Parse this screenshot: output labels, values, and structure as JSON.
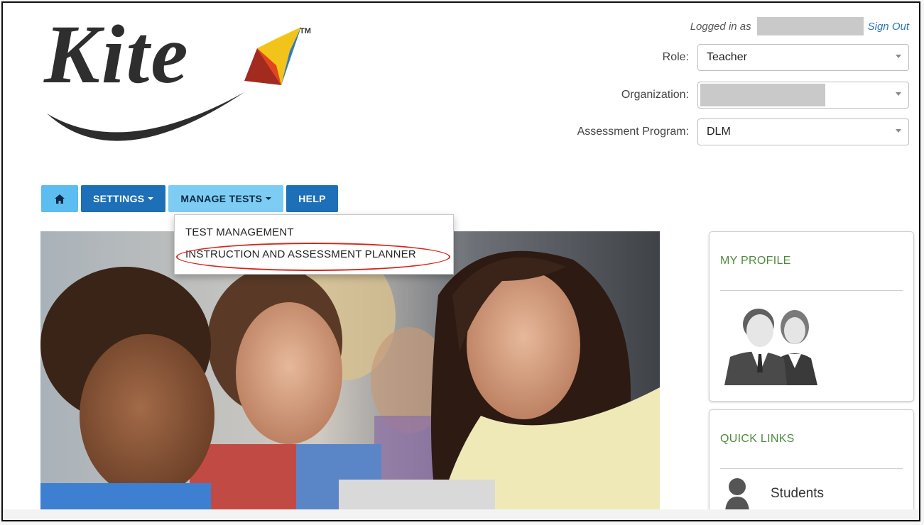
{
  "brand": {
    "name": "Kite",
    "trademark": "TM"
  },
  "session": {
    "logged_in_label": "Logged in as",
    "sign_out": "Sign Out"
  },
  "fields": {
    "role": {
      "label": "Role:",
      "value": "Teacher"
    },
    "organization": {
      "label": "Organization:",
      "value": ""
    },
    "program": {
      "label": "Assessment Program:",
      "value": "DLM"
    }
  },
  "nav": {
    "home_icon": "home-icon",
    "settings": "SETTINGS",
    "manage_tests": "MANAGE TESTS",
    "help": "HELP"
  },
  "dropdown": {
    "items": [
      "TEST MANAGEMENT",
      "INSTRUCTION AND ASSESSMENT PLANNER"
    ],
    "highlighted_index": 1,
    "highlight_color": "#d9251c"
  },
  "profile": {
    "title": "MY PROFILE",
    "icon": "users-profile-icon"
  },
  "quick_links": {
    "title": "QUICK LINKS",
    "items": [
      {
        "label": "Students",
        "icon": "student-icon"
      }
    ]
  },
  "colors": {
    "nav_blue": "#1d6fb7",
    "nav_light": "#7dccf3",
    "panel_title": "#4c8a3c",
    "link": "#2a74b8"
  }
}
